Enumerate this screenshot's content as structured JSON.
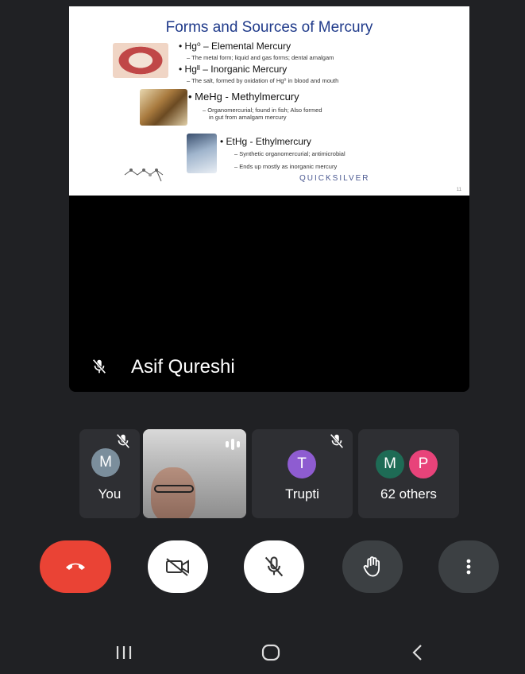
{
  "slide": {
    "title": "Forms and Sources of Mercury",
    "items": [
      {
        "heading": "Hg⁰ – Elemental Mercury",
        "detail": "– The metal form; liquid and gas forms; dental amalgam"
      },
      {
        "heading": "Hgᴵᴵ – Inorganic Mercury",
        "detail": "– The salt, formed by oxidation of Hg⁰ in blood and mouth"
      },
      {
        "heading": "MeHg - Methylmercury",
        "detail": "– Organomercurial; found in fish; Also formed",
        "detail2": "in gut from amalgam mercury"
      },
      {
        "heading": "EtHg - Ethylmercury",
        "detail": "– Synthetic organomercurial; antimicrobial",
        "detail2": "– Ends up mostly as inorganic mercury"
      }
    ],
    "logo": "QUICKSILVER",
    "page_number": "11"
  },
  "speaker": {
    "name": "Asif Qureshi",
    "muted": true
  },
  "participants": [
    {
      "label": "You",
      "initial": "M",
      "avatar_color": "#7b8e9c",
      "muted": true
    },
    {
      "label": "",
      "video": true,
      "speaking": true
    },
    {
      "label": "Trupti",
      "initial": "T",
      "avatar_color": "#8e5cd1",
      "muted": true
    },
    {
      "label": "62 others",
      "initials": [
        "M",
        "P"
      ],
      "avatar_colors": [
        "#1e6b55",
        "#e8437a"
      ]
    }
  ],
  "controls": {
    "end_call_color": "#ea4335",
    "items": [
      "end-call",
      "camera-off",
      "mic-off",
      "raise-hand",
      "more-options"
    ]
  },
  "nav": {
    "items": [
      "recent-apps",
      "home",
      "back"
    ]
  }
}
